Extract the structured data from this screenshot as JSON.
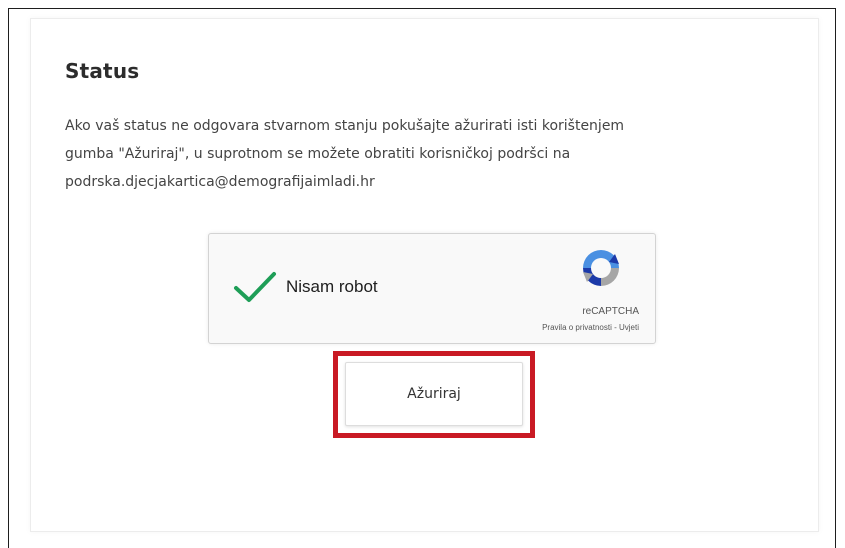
{
  "status": {
    "title": "Status",
    "description_lines": [
      "Ako vaš status ne odgovara stvarnom stanju pokušajte ažurirati isti korištenjem",
      "gumba \"Ažuriraj\", u suprotnom se možete obratiti korisničkoj podršci na",
      "podrska.djecjakartica@demografijaimladi.hr"
    ]
  },
  "recaptcha": {
    "label": "Nisam robot",
    "brand": "reCAPTCHA",
    "privacy_link": "Pravila o privatnosti",
    "separator": " - ",
    "terms_link": "Uvjeti",
    "checked": true,
    "check_color": "#1e9e57"
  },
  "actions": {
    "update_label": "Ažuriraj",
    "highlight_color": "#c91a24"
  }
}
